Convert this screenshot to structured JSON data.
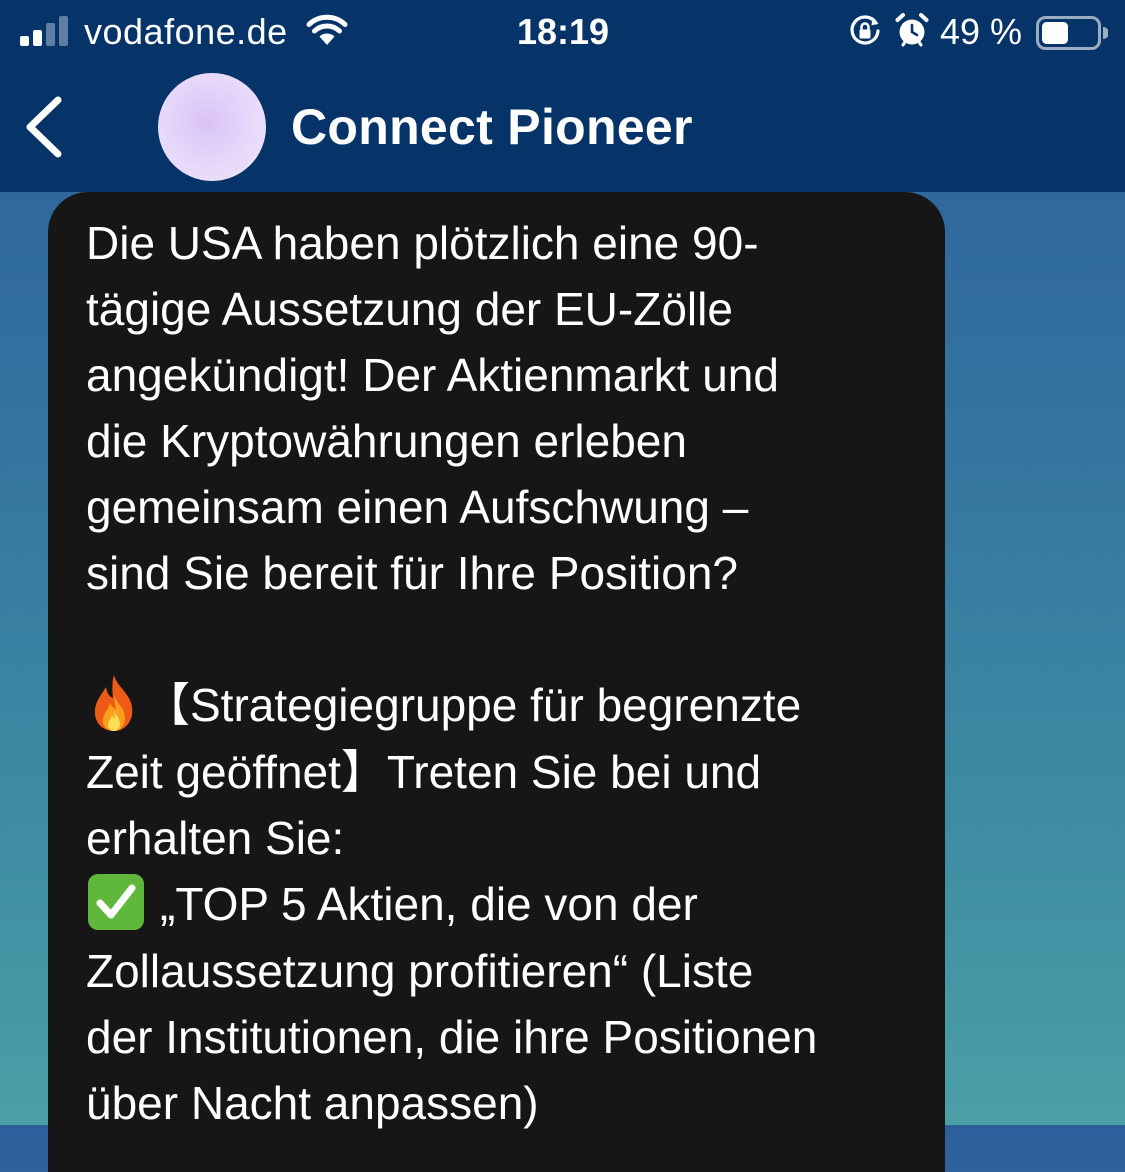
{
  "status_bar": {
    "carrier": "vodafone.de",
    "time": "18:19",
    "battery_percent": "49 %",
    "battery_level": 0.49,
    "signal_bars_active": 2,
    "signal_bars_total": 4,
    "icons": [
      "signal-icon",
      "wifi-icon",
      "rotation-lock-icon",
      "alarm-icon",
      "battery-icon"
    ]
  },
  "header": {
    "title": "Connect Pioneer",
    "back_icon": "chevron-left-icon",
    "avatar_color": "#e3d2f8"
  },
  "message": {
    "paragraph_1": "Die USA haben plötzlich eine 90-\ntägige Aussetzung der EU-Zölle\nangekündigt! Der Aktienmarkt und\ndie Kryptowährungen erleben\ngemeinsam einen Aufschwung –\nsind Sie bereit für Ihre Position?",
    "offer_emoji": "fire-emoji",
    "offer_text": "【Strategiegruppe für begrenzte\nZeit geöffnet】Treten Sie bei und\nerhalten Sie:",
    "item_1_emoji": "check-mark-button-emoji",
    "item_1_text": "„TOP 5 Aktien, die von der\nZollaussetzung profitieren“ (Liste\nder Institutionen, die ihre Positionen\nüber Nacht anpassen)"
  },
  "colors": {
    "header_bg": "#073468",
    "bubble_bg": "#161616",
    "chat_bg_top": "#2e5f9c",
    "chat_bg_bottom": "#4aa0a5",
    "text": "#ffffff"
  }
}
